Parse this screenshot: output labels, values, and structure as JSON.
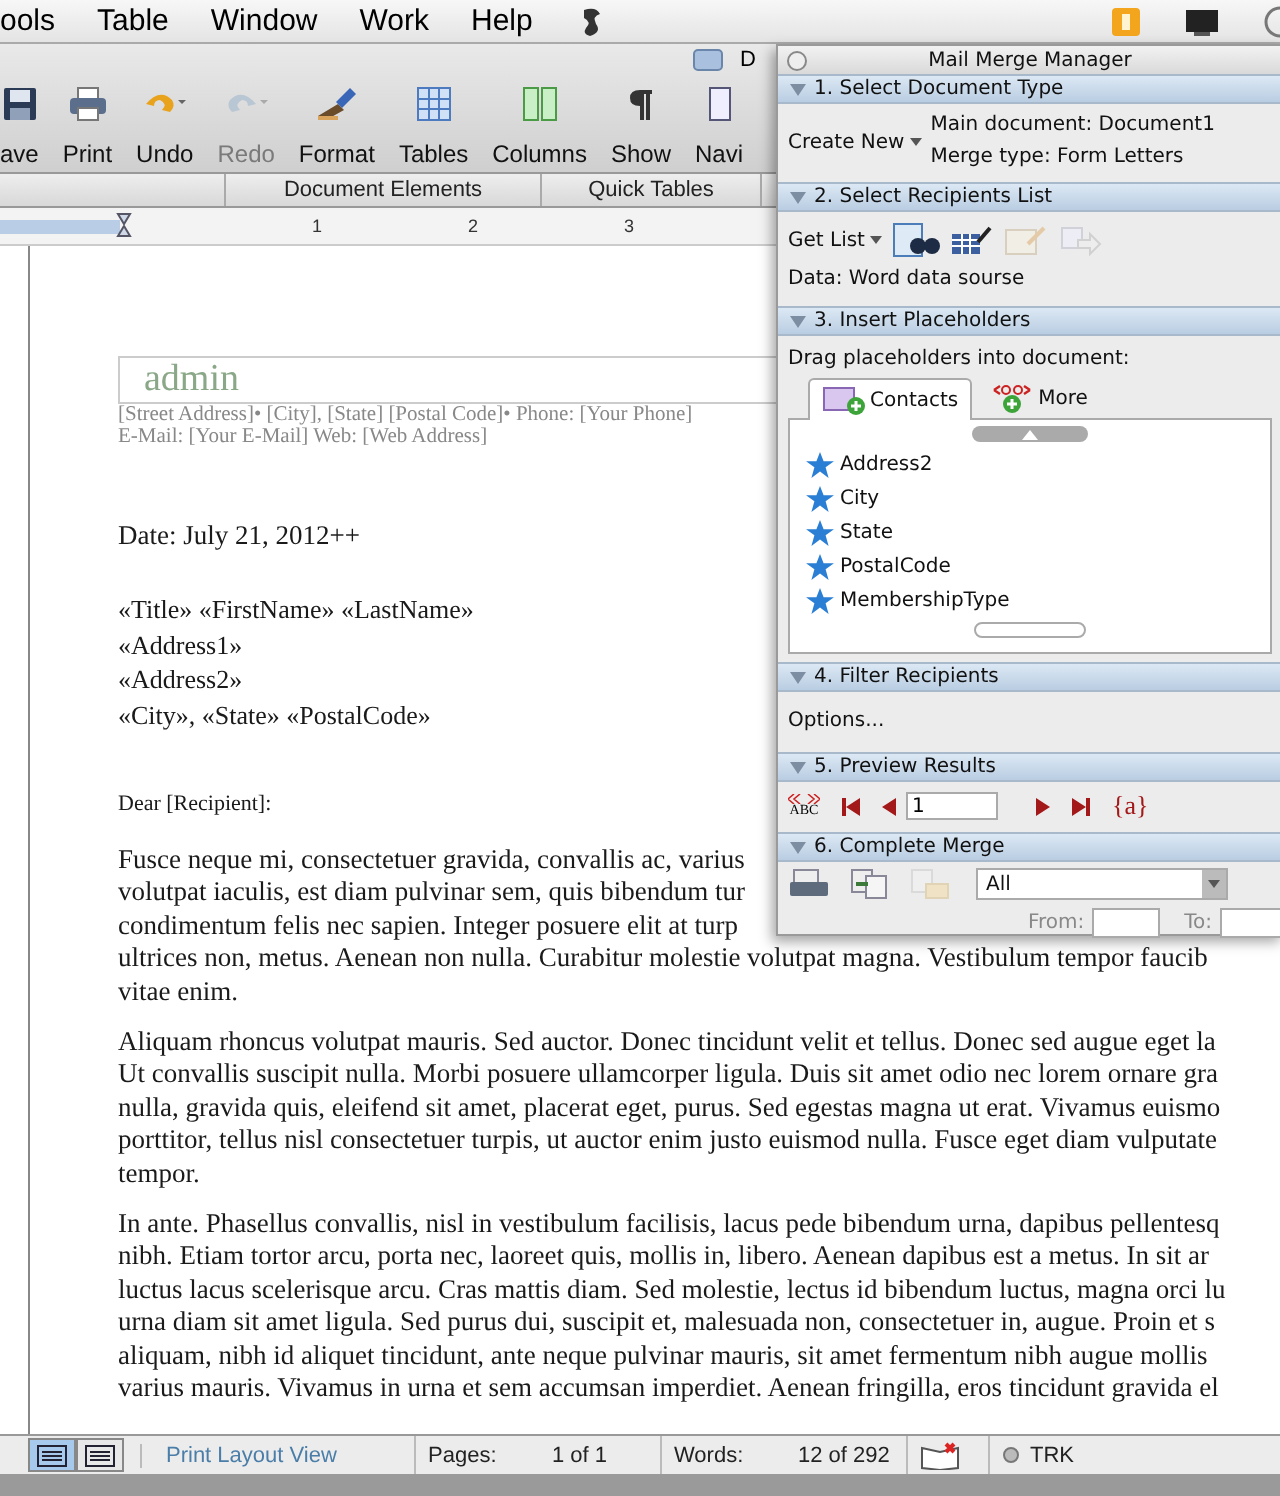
{
  "menu_bar": {
    "items": [
      "ools",
      "Table",
      "Window",
      "Work",
      "Help"
    ]
  },
  "toolbar": {
    "window_title": "D",
    "buttons": [
      {
        "label": "ave",
        "disabled": false
      },
      {
        "label": "Print",
        "disabled": false
      },
      {
        "label": "Undo",
        "disabled": false
      },
      {
        "label": "Redo",
        "disabled": true
      },
      {
        "label": "Format",
        "disabled": false
      },
      {
        "label": "Tables",
        "disabled": false
      },
      {
        "label": "Columns",
        "disabled": false
      },
      {
        "label": "Show",
        "disabled": false
      },
      {
        "label": "Navi",
        "disabled": false
      }
    ]
  },
  "ribbon": {
    "tabs": [
      "Document Elements",
      "Quick Tables"
    ]
  },
  "ruler": {
    "marks": [
      "1",
      "2",
      "3"
    ]
  },
  "document": {
    "letterhead": {
      "name": "admin",
      "address_lines": [
        "[Street Address]• [City], [State] [Postal Code]• Phone: [Your Phone]",
        "E-Mail: [Your E-Mail] Web: [Web Address]"
      ]
    },
    "date": "Date: July 21, 2012++",
    "address_block": [
      "«Title» «FirstName» «LastName»",
      "«Address1»",
      "«Address2»",
      "«City», «State» «PostalCode»"
    ],
    "salutation": "Dear [Recipient]:",
    "paragraphs": [
      [
        "Fusce neque mi, consectetuer gravida, convallis ac, varius",
        "volutpat iaculis, est diam pulvinar sem, quis bibendum tur",
        "condimentum felis nec sapien. Integer posuere elit at turp",
        "ultrices non, metus. Aenean non nulla. Curabitur molestie volutpat magna. Vestibulum tempor faucib",
        "vitae enim."
      ],
      [
        "Aliquam rhoncus volutpat mauris. Sed auctor. Donec tincidunt velit et tellus. Donec sed augue eget la",
        "Ut convallis suscipit nulla. Morbi posuere ullamcorper ligula. Duis sit amet odio nec lorem ornare gra",
        "nulla, gravida quis, eleifend sit amet, placerat eget, purus. Sed egestas magna ut erat. Vivamus euismo",
        "porttitor, tellus nisl consectetuer turpis, ut auctor enim justo euismod nulla. Fusce eget diam vulputate",
        "tempor."
      ],
      [
        "In ante. Phasellus convallis, nisl in vestibulum facilisis, lacus pede bibendum urna, dapibus pellentesq",
        "nibh. Etiam tortor arcu, porta nec, laoreet quis, mollis in, libero. Aenean dapibus est a metus. In sit ar",
        "luctus lacus scelerisque arcu. Cras mattis diam. Sed molestie, lectus id bibendum luctus, magna orci lu",
        "urna diam sit amet ligula. Sed purus dui, suscipit et, malesuada non, consectetuer in, augue. Proin et s",
        "aliquam, nibh id aliquet tincidunt, ante neque pulvinar mauris, sit amet fermentum nibh augue mollis",
        "varius mauris. Vivamus in urna et sem accumsan imperdiet. Aenean fringilla, eros tincidunt gravida el"
      ]
    ]
  },
  "mail_merge": {
    "title": "Mail Merge Manager",
    "sections": [
      {
        "kind": "document_type",
        "title": "1. Select Document Type",
        "expanded": true,
        "button": "Create New",
        "main_document": "Main document: Document1",
        "merge_type": "Merge type: Form Letters"
      },
      {
        "kind": "recipients",
        "title": "2. Select Recipients List",
        "expanded": true,
        "button": "Get List",
        "tools": [
          {
            "disabled": false
          },
          {
            "disabled": false
          },
          {
            "disabled": true
          },
          {
            "disabled": true
          }
        ],
        "data_source": "Data: Word data sourse"
      },
      {
        "kind": "placeholders",
        "title": "3. Insert Placeholders",
        "expanded": true,
        "hint": "Drag placeholders into document:",
        "tabs": [
          {
            "label": "Contacts",
            "selected": true
          },
          {
            "label": "More",
            "selected": false
          }
        ],
        "fields": [
          "Address2",
          "City",
          "State",
          "PostalCode",
          "MembershipType"
        ]
      },
      {
        "kind": "filter",
        "title": "4. Filter Recipients",
        "expanded": true,
        "button": "Options..."
      },
      {
        "kind": "preview",
        "title": "5. Preview Results",
        "expanded": true,
        "abc_label": "ABC",
        "record": "1",
        "view_fields_label": "{a}"
      },
      {
        "kind": "complete",
        "title": "6. Complete Merge",
        "expanded": true,
        "tools": [
          {
            "disabled": false
          },
          {
            "disabled": false
          },
          {
            "disabled": true
          }
        ],
        "range": "All",
        "from_label": "From:",
        "to_label": "To:"
      }
    ]
  },
  "status_bar": {
    "view_buttons": [
      {
        "selected": true
      },
      {
        "selected": false
      }
    ],
    "view": "Print Layout View",
    "pages_label": "Pages:",
    "pages": "1 of 1",
    "words_label": "Words:",
    "words": "12 of 292",
    "track": "TRK"
  }
}
